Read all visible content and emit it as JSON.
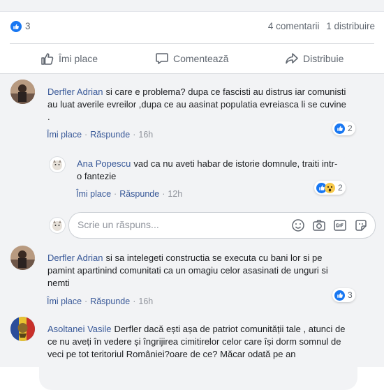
{
  "stats": {
    "like_count": "3",
    "comments": "4 comentarii",
    "shares": "1 distribuire"
  },
  "actions": {
    "like": "Îmi place",
    "comment": "Comentează",
    "share": "Distribuie"
  },
  "comments": [
    {
      "author": "Derfler Adrian",
      "text": "si care e problema? dupa ce fascisti au distrus iar comunisti au luat averile evreilor ,dupa ce au aasinat populatia evreiasca li se cuvine .",
      "like_label": "Îmi place",
      "reply_label": "Răspunde",
      "time": "16h",
      "reactions": "2"
    },
    {
      "author": "Ana Popescu",
      "text": "vad ca nu aveti habar de istorie domnule, traiti intr-o fantezie",
      "like_label": "Îmi place",
      "reply_label": "Răspunde",
      "time": "12h",
      "reactions": "2"
    },
    {
      "author": "Derfler Adrian",
      "text": "si sa intelegeti constructia se executa cu bani lor si pe pamint apartinind comunitati ca un omagiu celor asasinati de unguri si nemti",
      "like_label": "Îmi place",
      "reply_label": "Răspunde",
      "time": "16h",
      "reactions": "3"
    },
    {
      "author": "Asoltanei Vasile",
      "text": "Derfler dacă ești așa de patriot comunității tale , atunci de ce nu aveți în vedere și îngrijirea cimitirelor celor care își dorm somnul de veci pe tot teritoriul României?oare de ce? Măcar odată pe an"
    }
  ],
  "reply_box": {
    "placeholder": "Scrie un răspuns..."
  },
  "icons": [
    "like-icon",
    "comment-icon",
    "share-icon",
    "emoji-icon",
    "camera-icon",
    "gif-icon",
    "sticker-icon"
  ],
  "colors": {
    "link": "#385898",
    "accent": "#1877f2",
    "muted": "#90949c"
  }
}
